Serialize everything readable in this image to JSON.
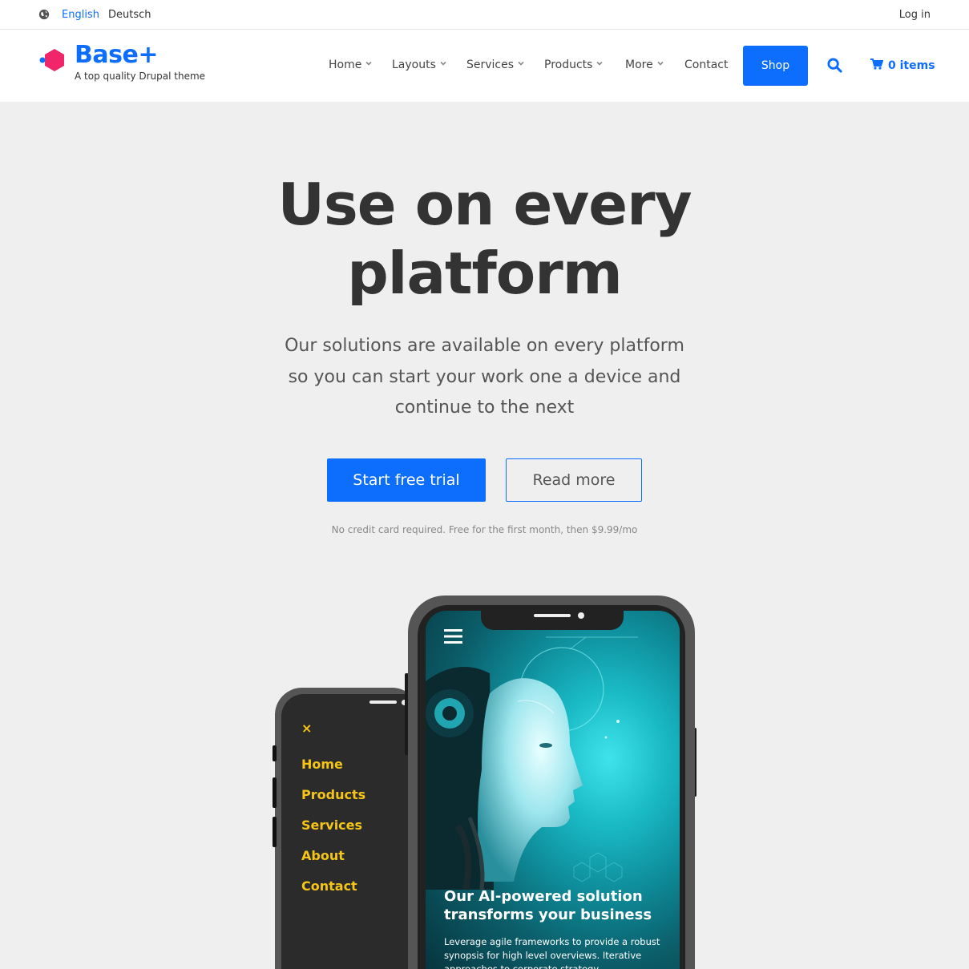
{
  "topbar": {
    "languages": [
      "English",
      "Deutsch"
    ],
    "active_language": "English",
    "login": "Log in"
  },
  "header": {
    "site_name": "Base+",
    "slogan": "A top quality Drupal theme",
    "nav": [
      {
        "label": "Home",
        "has_dropdown": true
      },
      {
        "label": "Layouts",
        "has_dropdown": true
      },
      {
        "label": "Services",
        "has_dropdown": true
      },
      {
        "label": "Products",
        "has_dropdown": true
      },
      {
        "label": "More",
        "has_dropdown": true
      },
      {
        "label": "Contact",
        "has_dropdown": false
      }
    ],
    "shop": "Shop",
    "cart": "0 items"
  },
  "hero": {
    "title_line1": "Use on every",
    "title_line2": "platform",
    "subtitle_line1": "Our solutions are available on every platform",
    "subtitle_line2": "so you can start your work one a device and",
    "subtitle_line3": "continue to the next",
    "primary_button": "Start free trial",
    "secondary_button": "Read more",
    "note": "No credit card required. Free for the first month, then $9.99/mo"
  },
  "mockup": {
    "menu_close": "×",
    "menu_items": [
      "Home",
      "Products",
      "Services",
      "About",
      "Contact"
    ],
    "promo_title_line1": "Our AI-powered solution",
    "promo_title_line2": "transforms your business",
    "promo_body": "Leverage agile frameworks to provide a robust synopsis for high level overviews. Iterative approaches to corporate strategy"
  },
  "colors": {
    "accent": "#0d6efd",
    "menu_yellow": "#f5c518",
    "background": "#efefef"
  }
}
